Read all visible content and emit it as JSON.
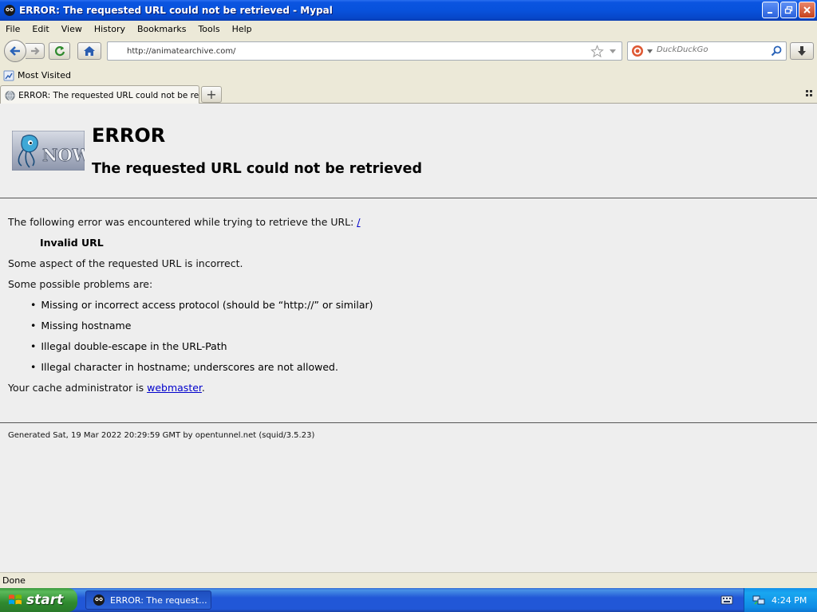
{
  "window": {
    "title": "ERROR: The requested URL could not be retrieved - Mypal"
  },
  "menu": [
    "File",
    "Edit",
    "View",
    "History",
    "Bookmarks",
    "Tools",
    "Help"
  ],
  "nav": {
    "url": "http://animatearchive.com/",
    "search_placeholder": "DuckDuckGo"
  },
  "bookmarks": {
    "most_visited": "Most Visited"
  },
  "tab": {
    "label": "ERROR: The requested URL could not be ret...",
    "new_tab": "+"
  },
  "page": {
    "heading": "ERROR",
    "subheading": "The requested URL could not be retrieved",
    "intro": "The following error was encountered while trying to retrieve the URL: ",
    "intro_link": "/",
    "error_type": "Invalid URL",
    "desc": "Some aspect of the requested URL is incorrect.",
    "problems_intro": "Some possible problems are:",
    "problems": [
      "Missing or incorrect access protocol (should be “http://” or similar)",
      "Missing hostname",
      "Illegal double-escape in the URL-Path",
      "Illegal character in hostname; underscores are not allowed."
    ],
    "admin_prefix": "Your cache administrator is ",
    "admin_link": "webmaster",
    "admin_suffix": ".",
    "footer": "Generated Sat, 19 Mar 2022 20:29:59 GMT by opentunnel.net (squid/3.5.23)",
    "logo_text": "NOW"
  },
  "status": {
    "text": "Done"
  },
  "taskbar": {
    "start": "start",
    "task_label": "ERROR: The request...",
    "clock": "4:24 PM"
  },
  "colors": {
    "titlebar": "#0852dc",
    "link": "#0000cc",
    "page_bg": "#eeeeee",
    "chrome_bg": "#ece9d8",
    "start_green": "#2f8a2f"
  }
}
